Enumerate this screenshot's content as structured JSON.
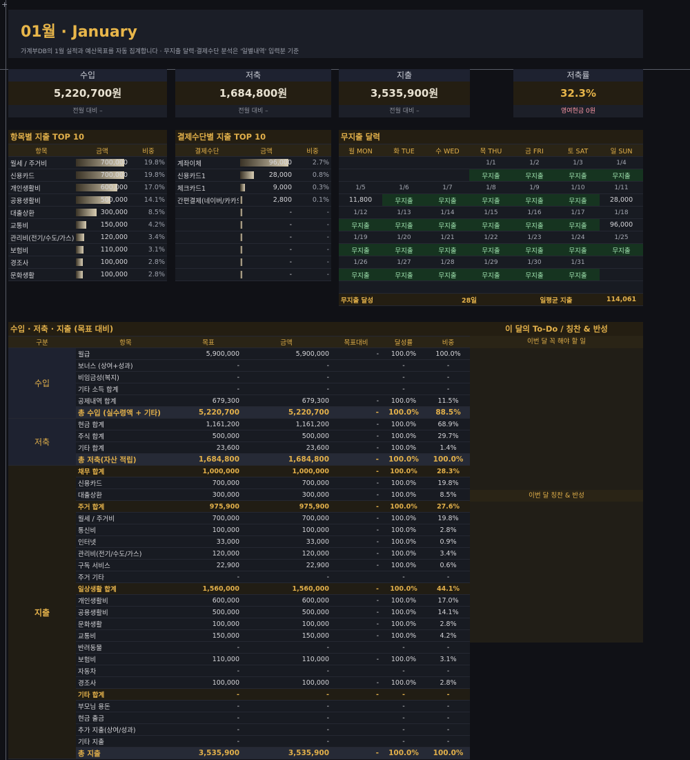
{
  "header": {
    "title": "01월 · January",
    "subtitle": "가계부DB의 1월 실적과 예산목표를 자동 집계합니다 · 무지출 달력·결제수단 분석은 '일별내역' 입력분 기준"
  },
  "kpis": [
    {
      "label": "수입",
      "value": "5,220,700원",
      "sub": "전월 대비 –"
    },
    {
      "label": "저축",
      "value": "1,684,800원",
      "sub": "전월 대비 –"
    },
    {
      "label": "지출",
      "value": "3,535,900원",
      "sub": "전월 대비 –"
    },
    {
      "label": "저축률",
      "value": "32.3%",
      "sub": "영여현금 0원"
    }
  ],
  "top10": {
    "title": "항목별 지출 TOP 10",
    "headers": [
      "항목",
      "금액",
      "비중"
    ],
    "rows": [
      {
        "name": "월세 / 주거비",
        "amount": "700,000",
        "pct": "19.8%",
        "ratio": 1.0
      },
      {
        "name": "신용카드",
        "amount": "700,000",
        "pct": "19.8%",
        "ratio": 1.0
      },
      {
        "name": "개인생활비",
        "amount": "600,000",
        "pct": "17.0%",
        "ratio": 0.857
      },
      {
        "name": "공용생활비",
        "amount": "500,000",
        "pct": "14.1%",
        "ratio": 0.714
      },
      {
        "name": "대출상환",
        "amount": "300,000",
        "pct": "8.5%",
        "ratio": 0.429
      },
      {
        "name": "교통비",
        "amount": "150,000",
        "pct": "4.2%",
        "ratio": 0.214
      },
      {
        "name": "관리비(전기/수도/가스)",
        "amount": "120,000",
        "pct": "3.4%",
        "ratio": 0.171
      },
      {
        "name": "보험비",
        "amount": "110,000",
        "pct": "3.1%",
        "ratio": 0.157
      },
      {
        "name": "경조사",
        "amount": "100,000",
        "pct": "2.8%",
        "ratio": 0.143
      },
      {
        "name": "문화생활",
        "amount": "100,000",
        "pct": "2.8%",
        "ratio": 0.143
      }
    ]
  },
  "payment": {
    "title": "결제수단별 지출 TOP 10",
    "headers": [
      "결제수단",
      "금액",
      "비중"
    ],
    "rows": [
      {
        "name": "계좌이체",
        "amount": "96,000",
        "pct": "2.7%",
        "ratio": 1.0
      },
      {
        "name": "신용카드1",
        "amount": "28,000",
        "pct": "0.8%",
        "ratio": 0.29
      },
      {
        "name": "체크카드1",
        "amount": "9,000",
        "pct": "0.3%",
        "ratio": 0.094
      },
      {
        "name": "간편결제(네이버/카카오)",
        "amount": "2,800",
        "pct": "0.1%",
        "ratio": 0.03
      },
      {
        "name": "",
        "amount": "-",
        "pct": "-",
        "ratio": 0.03
      },
      {
        "name": "",
        "amount": "-",
        "pct": "-",
        "ratio": 0.03
      },
      {
        "name": "",
        "amount": "-",
        "pct": "-",
        "ratio": 0.03
      },
      {
        "name": "",
        "amount": "-",
        "pct": "-",
        "ratio": 0.03
      },
      {
        "name": "",
        "amount": "-",
        "pct": "-",
        "ratio": 0.03
      },
      {
        "name": "",
        "amount": "-",
        "pct": "-",
        "ratio": 0.03
      }
    ]
  },
  "calendar": {
    "title": "무지출 달력",
    "days": [
      "월 MON",
      "화 TUE",
      "수 WED",
      "목 THU",
      "금 FRI",
      "토 SAT",
      "일 SUN"
    ],
    "weeks": [
      {
        "dates": [
          "",
          "",
          "",
          "1/1",
          "1/2",
          "1/3",
          "1/4"
        ],
        "vals": [
          "",
          "",
          "",
          "무지출",
          "무지출",
          "무지출",
          "무지출"
        ]
      },
      {
        "dates": [
          "1/5",
          "1/6",
          "1/7",
          "1/8",
          "1/9",
          "1/10",
          "1/11"
        ],
        "vals": [
          "11,800",
          "무지출",
          "무지출",
          "무지출",
          "무지출",
          "무지출",
          "28,000"
        ]
      },
      {
        "dates": [
          "1/12",
          "1/13",
          "1/14",
          "1/15",
          "1/16",
          "1/17",
          "1/18"
        ],
        "vals": [
          "무지출",
          "무지출",
          "무지출",
          "무지출",
          "무지출",
          "무지출",
          "96,000"
        ]
      },
      {
        "dates": [
          "1/19",
          "1/20",
          "1/21",
          "1/22",
          "1/23",
          "1/24",
          "1/25"
        ],
        "vals": [
          "무지출",
          "무지출",
          "무지출",
          "무지출",
          "무지출",
          "무지출",
          "무지출"
        ]
      },
      {
        "dates": [
          "1/26",
          "1/27",
          "1/28",
          "1/29",
          "1/30",
          "1/31",
          ""
        ],
        "vals": [
          "무지출",
          "무지출",
          "무지출",
          "무지출",
          "무지출",
          "무지출",
          ""
        ]
      }
    ],
    "footer": {
      "label1": "무지출 달성",
      "value1": "28일",
      "label2": "일평균 지출",
      "value2": "114,061"
    }
  },
  "main": {
    "title": "수입 · 저축 · 지출 (목표 대비)",
    "headers": [
      "구분",
      "항목",
      "목표",
      "금액",
      "목표대비",
      "달성률",
      "비중"
    ],
    "sections": [
      {
        "name": "수입",
        "rows": [
          {
            "item": "월급",
            "target": "5,900,000",
            "amount": "5,900,000",
            "diff": "-",
            "rate": "100.0%",
            "share": "100.0%",
            "type": "row"
          },
          {
            "item": "보너스 (상여+성과)",
            "target": "-",
            "amount": "-",
            "diff": "",
            "rate": "-",
            "share": "-",
            "type": "row"
          },
          {
            "item": "비임금성(복지)",
            "target": "-",
            "amount": "-",
            "diff": "",
            "rate": "-",
            "share": "-",
            "type": "row"
          },
          {
            "item": "기타 소득 합계",
            "target": "-",
            "amount": "-",
            "diff": "",
            "rate": "-",
            "share": "-",
            "type": "row"
          },
          {
            "item": "공제내역 합계",
            "target": "679,300",
            "amount": "679,300",
            "diff": "-",
            "rate": "100.0%",
            "share": "11.5%",
            "type": "row"
          },
          {
            "item": "총 수입 (실수령액 + 기타)",
            "target": "5,220,700",
            "amount": "5,220,700",
            "diff": "-",
            "rate": "100.0%",
            "share": "88.5%",
            "type": "total"
          }
        ]
      },
      {
        "name": "저축",
        "rows": [
          {
            "item": "현금 합계",
            "target": "1,161,200",
            "amount": "1,161,200",
            "diff": "-",
            "rate": "100.0%",
            "share": "68.9%",
            "type": "row"
          },
          {
            "item": "주식 합계",
            "target": "500,000",
            "amount": "500,000",
            "diff": "-",
            "rate": "100.0%",
            "share": "29.7%",
            "type": "row"
          },
          {
            "item": "기타 합계",
            "target": "23,600",
            "amount": "23,600",
            "diff": "-",
            "rate": "100.0%",
            "share": "1.4%",
            "type": "row"
          },
          {
            "item": "총 저축(자산 적립)",
            "target": "1,684,800",
            "amount": "1,684,800",
            "diff": "-",
            "rate": "100.0%",
            "share": "100.0%",
            "type": "total"
          }
        ]
      },
      {
        "name": "지출",
        "rows": [
          {
            "item": "채무 합계",
            "target": "1,000,000",
            "amount": "1,000,000",
            "diff": "-",
            "rate": "100.0%",
            "share": "28.3%",
            "type": "sub"
          },
          {
            "item": "신용카드",
            "target": "700,000",
            "amount": "700,000",
            "diff": "-",
            "rate": "100.0%",
            "share": "19.8%",
            "type": "row"
          },
          {
            "item": "대출상환",
            "target": "300,000",
            "amount": "300,000",
            "diff": "-",
            "rate": "100.0%",
            "share": "8.5%",
            "type": "row"
          },
          {
            "item": "주거 합계",
            "target": "975,900",
            "amount": "975,900",
            "diff": "-",
            "rate": "100.0%",
            "share": "27.6%",
            "type": "sub"
          },
          {
            "item": "월세 / 주거비",
            "target": "700,000",
            "amount": "700,000",
            "diff": "-",
            "rate": "100.0%",
            "share": "19.8%",
            "type": "row"
          },
          {
            "item": "통신비",
            "target": "100,000",
            "amount": "100,000",
            "diff": "-",
            "rate": "100.0%",
            "share": "2.8%",
            "type": "row"
          },
          {
            "item": "인터넷",
            "target": "33,000",
            "amount": "33,000",
            "diff": "-",
            "rate": "100.0%",
            "share": "0.9%",
            "type": "row"
          },
          {
            "item": "관리비(전기/수도/가스)",
            "target": "120,000",
            "amount": "120,000",
            "diff": "-",
            "rate": "100.0%",
            "share": "3.4%",
            "type": "row"
          },
          {
            "item": "구독 서비스",
            "target": "22,900",
            "amount": "22,900",
            "diff": "-",
            "rate": "100.0%",
            "share": "0.6%",
            "type": "row"
          },
          {
            "item": "주거 기타",
            "target": "-",
            "amount": "-",
            "diff": "",
            "rate": "-",
            "share": "-",
            "type": "row"
          },
          {
            "item": "일상생활 합계",
            "target": "1,560,000",
            "amount": "1,560,000",
            "diff": "-",
            "rate": "100.0%",
            "share": "44.1%",
            "type": "sub"
          },
          {
            "item": "개인생활비",
            "target": "600,000",
            "amount": "600,000",
            "diff": "-",
            "rate": "100.0%",
            "share": "17.0%",
            "type": "row"
          },
          {
            "item": "공용생활비",
            "target": "500,000",
            "amount": "500,000",
            "diff": "-",
            "rate": "100.0%",
            "share": "14.1%",
            "type": "row"
          },
          {
            "item": "문화생활",
            "target": "100,000",
            "amount": "100,000",
            "diff": "-",
            "rate": "100.0%",
            "share": "2.8%",
            "type": "row"
          },
          {
            "item": "교통비",
            "target": "150,000",
            "amount": "150,000",
            "diff": "-",
            "rate": "100.0%",
            "share": "4.2%",
            "type": "row"
          },
          {
            "item": "반려동물",
            "target": "-",
            "amount": "-",
            "diff": "",
            "rate": "-",
            "share": "-",
            "type": "row"
          },
          {
            "item": "보험비",
            "target": "110,000",
            "amount": "110,000",
            "diff": "-",
            "rate": "100.0%",
            "share": "3.1%",
            "type": "row"
          },
          {
            "item": "자동차",
            "target": "-",
            "amount": "-",
            "diff": "",
            "rate": "-",
            "share": "-",
            "type": "row"
          },
          {
            "item": "경조사",
            "target": "100,000",
            "amount": "100,000",
            "diff": "-",
            "rate": "100.0%",
            "share": "2.8%",
            "type": "row"
          },
          {
            "item": "기타 합계",
            "target": "-",
            "amount": "-",
            "diff": "-",
            "rate": "-",
            "share": "-",
            "type": "sub"
          },
          {
            "item": "부모님 용돈",
            "target": "-",
            "amount": "-",
            "diff": "",
            "rate": "-",
            "share": "-",
            "type": "row"
          },
          {
            "item": "현금 출금",
            "target": "-",
            "amount": "-",
            "diff": "",
            "rate": "-",
            "share": "-",
            "type": "row"
          },
          {
            "item": "추가 지출(상여/성과)",
            "target": "-",
            "amount": "-",
            "diff": "",
            "rate": "-",
            "share": "-",
            "type": "row"
          },
          {
            "item": "기타 지출",
            "target": "-",
            "amount": "-",
            "diff": "",
            "rate": "-",
            "share": "-",
            "type": "row"
          },
          {
            "item": "총 지출",
            "target": "3,535,900",
            "amount": "3,535,900",
            "diff": "-",
            "rate": "100.0%",
            "share": "100.0%",
            "type": "total"
          }
        ]
      }
    ]
  },
  "todo": {
    "title": "이 달의 To-Do  /  칭찬 & 반성",
    "todo_label": "이번 달 꼭 해야 할 일",
    "praise_label": "이번 달 칭찬 & 반성"
  }
}
